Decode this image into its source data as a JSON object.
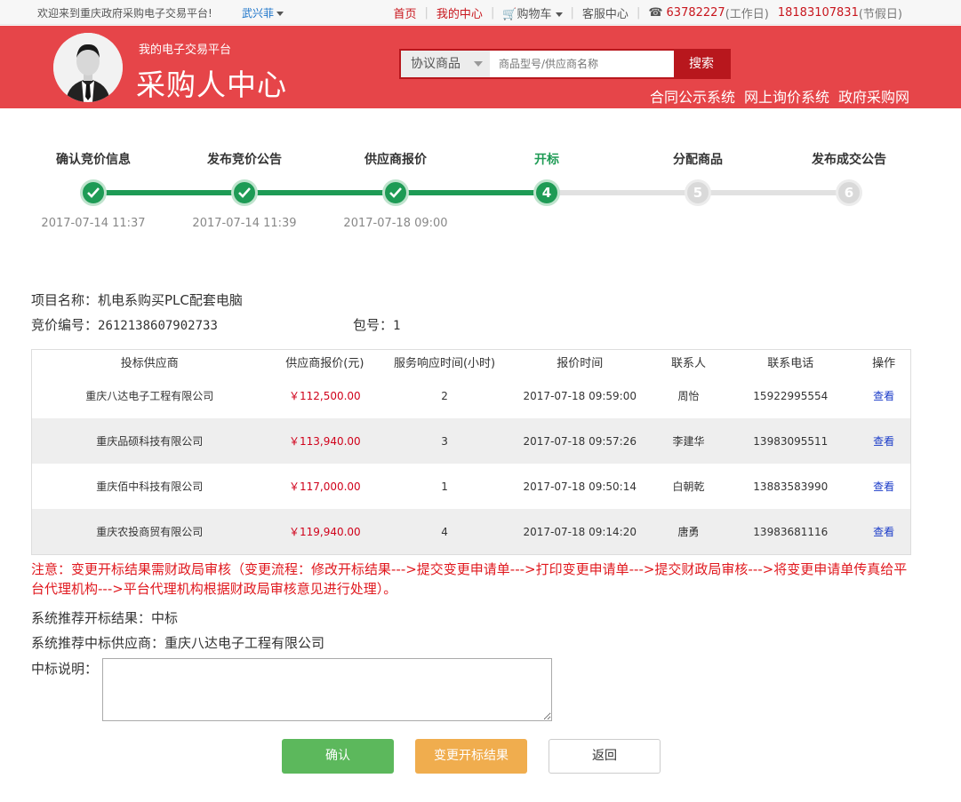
{
  "topbar": {
    "welcome": "欢迎来到重庆政府采购电子交易平台!",
    "user": "武兴菲",
    "nav": {
      "home": "首页",
      "my_center": "我的中心",
      "cart": "购物车",
      "service": "客服中心",
      "phone1": "63782227",
      "phone1_note": "(工作日)",
      "phone2": "18183107831",
      "phone2_note": "(节假日)"
    }
  },
  "header": {
    "subtitle": "我的电子交易平台",
    "title": "采购人中心",
    "search": {
      "category": "协议商品",
      "placeholder": "商品型号/供应商名称",
      "button": "搜索"
    },
    "links": [
      "合同公示系统",
      "网上询价系统",
      "政府采购网"
    ]
  },
  "steps": [
    {
      "label": "确认竞价信息",
      "status": "done",
      "date": "2017-07-14 11:37"
    },
    {
      "label": "发布竞价公告",
      "status": "done",
      "date": "2017-07-14 11:39"
    },
    {
      "label": "供应商报价",
      "status": "done",
      "date": "2017-07-18 09:00"
    },
    {
      "label": "开标",
      "status": "current",
      "num": "4",
      "date": ""
    },
    {
      "label": "分配商品",
      "status": "todo",
      "num": "5",
      "date": ""
    },
    {
      "label": "发布成交公告",
      "status": "todo",
      "num": "6",
      "date": ""
    }
  ],
  "project": {
    "name_label": "项目名称：",
    "name": "机电系购买PLC配套电脑",
    "code_label": "竞价编号：",
    "code": "2612138607902733",
    "pkg_label": "包号：",
    "pkg": "1"
  },
  "table": {
    "headers": [
      "投标供应商",
      "供应商报价(元)",
      "服务响应时间(小时)",
      "报价时间",
      "联系人",
      "联系电话",
      "操作"
    ],
    "rows": [
      {
        "supplier": "重庆八达电子工程有限公司",
        "price": "￥112,500.00",
        "response": "2",
        "time": "2017-07-18 09:59:00",
        "contact": "周怡",
        "phone": "15922995554",
        "action": "查看"
      },
      {
        "supplier": "重庆品硕科技有限公司",
        "price": "￥113,940.00",
        "response": "3",
        "time": "2017-07-18 09:57:26",
        "contact": "李建华",
        "phone": "13983095511",
        "action": "查看"
      },
      {
        "supplier": "重庆佰中科技有限公司",
        "price": "￥117,000.00",
        "response": "1",
        "time": "2017-07-18 09:50:14",
        "contact": "白朝乾",
        "phone": "13883583990",
        "action": "查看"
      },
      {
        "supplier": "重庆农投商贸有限公司",
        "price": "￥119,940.00",
        "response": "4",
        "time": "2017-07-18 09:14:20",
        "contact": "唐勇",
        "phone": "13983681116",
        "action": "查看"
      }
    ]
  },
  "notice": "注意：变更开标结果需财政局审核（变更流程：修改开标结果--->提交变更申请单--->打印变更申请单--->提交财政局审核--->将变更申请单传真给平台代理机构--->平台代理机构根据财政局审核意见进行处理）。",
  "result": {
    "recommend_label": "系统推荐开标结果：",
    "recommend": "中标",
    "winner_label": "系统推荐中标供应商：",
    "winner": "重庆八达电子工程有限公司",
    "desc_label": "中标说明："
  },
  "buttons": {
    "confirm": "确认",
    "change": "变更开标结果",
    "back": "返回"
  }
}
